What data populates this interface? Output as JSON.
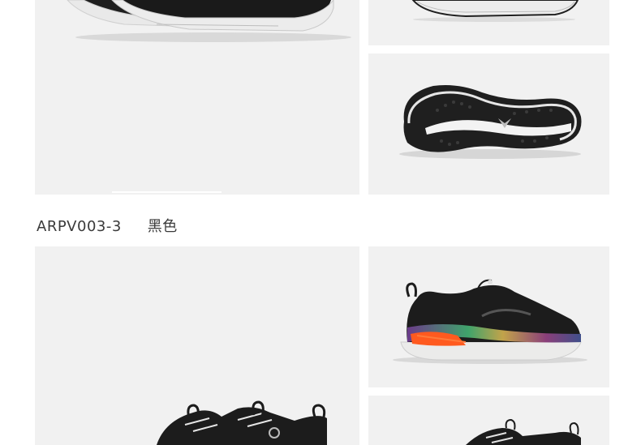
{
  "variant": {
    "code": "ARPV003-3",
    "color_name": "黑色"
  },
  "images": [
    {
      "name": "top-large-shoe-side",
      "icon": "shoe-side-view"
    },
    {
      "name": "top-shoe-cropped-sole",
      "icon": "shoe-sole-edge"
    },
    {
      "name": "top-shoe-outsole",
      "icon": "shoe-outsole"
    },
    {
      "name": "bottom-large-shoe",
      "icon": "shoe-pair-view"
    },
    {
      "name": "bottom-shoe-side",
      "icon": "shoe-side-view"
    },
    {
      "name": "bottom-shoe-cropped",
      "icon": "shoe-top-view"
    }
  ],
  "colors": {
    "panel_bg": "#f1f1f1",
    "shoe_black": "#1c1c1c",
    "sole_white": "#e8e8e6",
    "accent_orange": "#ff5a1f"
  }
}
